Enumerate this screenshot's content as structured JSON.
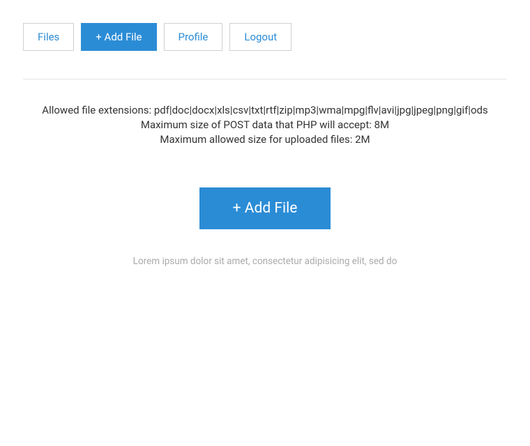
{
  "nav": {
    "files": "Files",
    "add_file": "+ Add File",
    "profile": "Profile",
    "logout": "Logout"
  },
  "info": {
    "allowed_extensions": "Allowed file extensions: pdf|doc|docx|xls|csv|txt|rtf|zip|mp3|wma|mpg|flv|avi|jpg|jpeg|png|gif|ods",
    "max_post": "Maximum size of POST data that PHP will accept: 8M",
    "max_upload": "Maximum allowed size for uploaded files: 2M"
  },
  "main": {
    "add_file_label": "+ Add File",
    "help_text": "Lorem ipsum dolor sit amet, consectetur adipisicing elit, sed do"
  }
}
